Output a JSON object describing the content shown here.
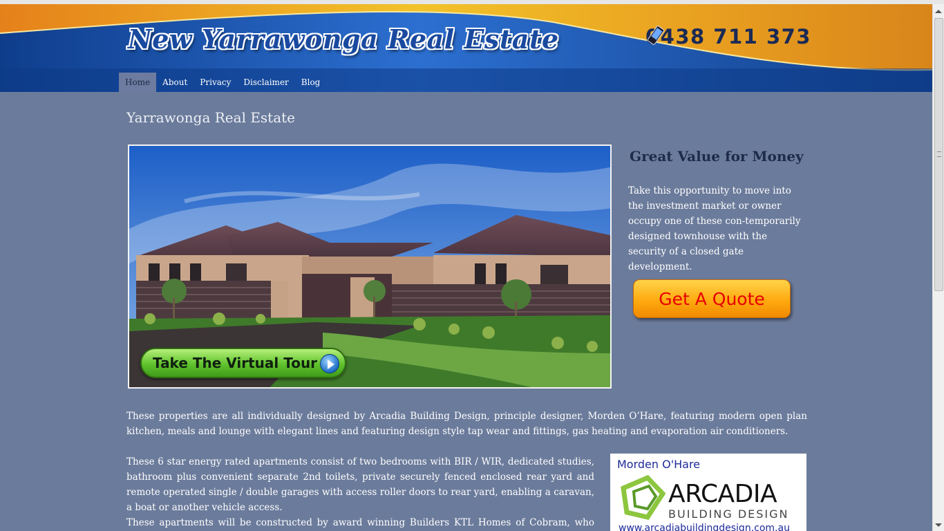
{
  "header": {
    "site_title": "New Yarrawonga Real Estate",
    "phone": "0438 711 373",
    "phone_icon": "mobile-phone-icon"
  },
  "nav": {
    "items": [
      {
        "label": "Home",
        "active": true
      },
      {
        "label": "About",
        "active": false
      },
      {
        "label": "Privacy",
        "active": false
      },
      {
        "label": "Disclaimer",
        "active": false
      },
      {
        "label": "Blog",
        "active": false
      }
    ]
  },
  "main": {
    "page_title": "Yarrawonga Real Estate",
    "hero": {
      "tour_button": "Take The Virtual Tour"
    },
    "sidebar": {
      "heading": "Great Value for Money",
      "text": "Take this opportunity to move into the investment market or owner occupy one of these con-temporarily designed townhouse with the security of a closed gate development.",
      "quote_button": "Get A Quote"
    },
    "paragraphs": [
      "These properties are all individually designed by Arcadia Building Design, principle designer, Morden O’Hare, featuring modern open plan kitchen, meals and lounge with elegant lines and featuring design style tap wear and fittings, gas heating and evaporation air conditioners.",
      "These 6 star energy rated apartments consist of two bedrooms with BIR / WIR, dedicated studies, bathroom plus convenient separate 2nd toilets, private securely fenced enclosed rear yard and remote operated single / double garages with access roller doors to rear yard, enabling a caravan, a boat or another vehicle access.",
      "These apartments will be constructed by award winning Builders KTL Homes of Cobram, who pride"
    ],
    "logo": {
      "name": "Morden O'Hare",
      "brand": "ARCADIA",
      "subtitle": "BUILDING DESIGN",
      "url": "www.arcadiabuildingdesign.com.au"
    }
  },
  "colors": {
    "page_bg": "#6b7b9b",
    "header_blue": "#1b4f9e",
    "header_orange": "#e8961e",
    "quote_text": "#e60000"
  }
}
